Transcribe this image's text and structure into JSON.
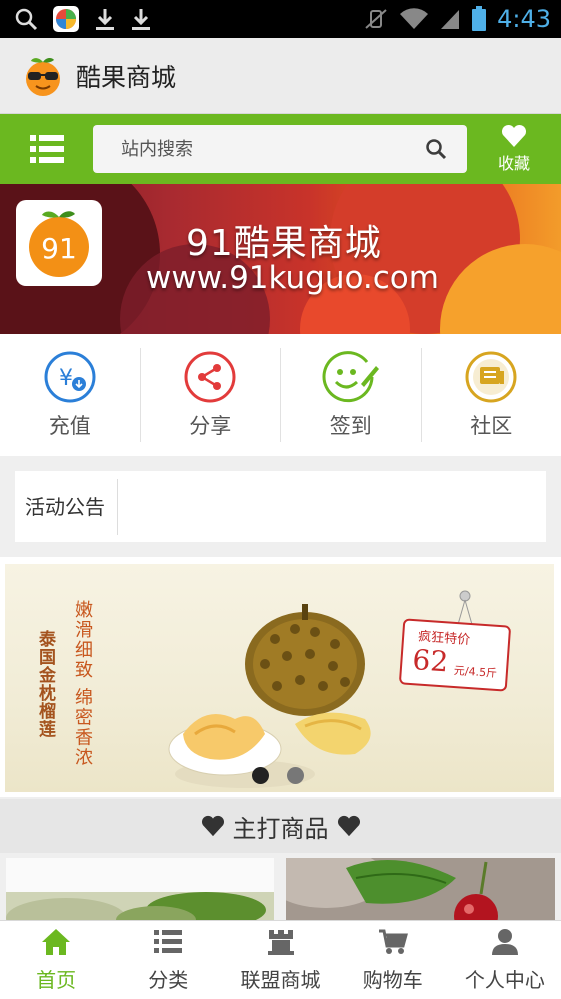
{
  "status_bar": {
    "time": "4:43"
  },
  "app": {
    "title": "酷果商城"
  },
  "search": {
    "placeholder": "站内搜索",
    "favorite_label": "收藏"
  },
  "banner": {
    "title": "91酷果商城",
    "url": "www.91kuguo.com",
    "logo_text": "91"
  },
  "actions": [
    {
      "label": "充值",
      "icon": "recharge-icon",
      "color": "#2b7fd8"
    },
    {
      "label": "分享",
      "icon": "share-icon",
      "color": "#e23b3b"
    },
    {
      "label": "签到",
      "icon": "checkin-icon",
      "color": "#6bb820"
    },
    {
      "label": "社区",
      "icon": "community-icon",
      "color": "#d7a520"
    }
  ],
  "notice": {
    "label": "活动公告"
  },
  "promo": {
    "side_text": "泰国金枕榴莲",
    "poem": "嫩滑细致 绵密香浓",
    "tag_title": "疯狂特价",
    "price": "62",
    "unit": "元/4.5斤",
    "slides": 2,
    "active_slide": 1
  },
  "section": {
    "title": "主打商品"
  },
  "bottom_nav": [
    {
      "label": "首页",
      "icon": "home-icon",
      "active": true
    },
    {
      "label": "分类",
      "icon": "list-icon",
      "active": false
    },
    {
      "label": "联盟商城",
      "icon": "store-icon",
      "active": false
    },
    {
      "label": "购物车",
      "icon": "cart-icon",
      "active": false
    },
    {
      "label": "个人中心",
      "icon": "user-icon",
      "active": false
    }
  ],
  "colors": {
    "accent": "#6bb820",
    "status_time": "#4fb0e8"
  }
}
